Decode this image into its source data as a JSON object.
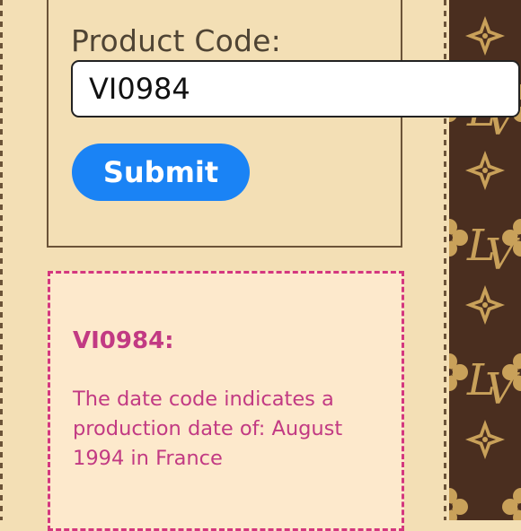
{
  "form": {
    "label": "Product Code:",
    "code_value": "VI0984",
    "submit_label": "Submit"
  },
  "result": {
    "code_heading": "VI0984:",
    "message": "The date code indicates a production date of: August 1994 in France"
  },
  "colors": {
    "background": "#f3dfb5",
    "button": "#1a83f5",
    "result_text": "#c23a83",
    "result_border": "#d4377f",
    "monogram_bg": "#4a2e1f",
    "monogram_gold": "#c9a15a"
  }
}
